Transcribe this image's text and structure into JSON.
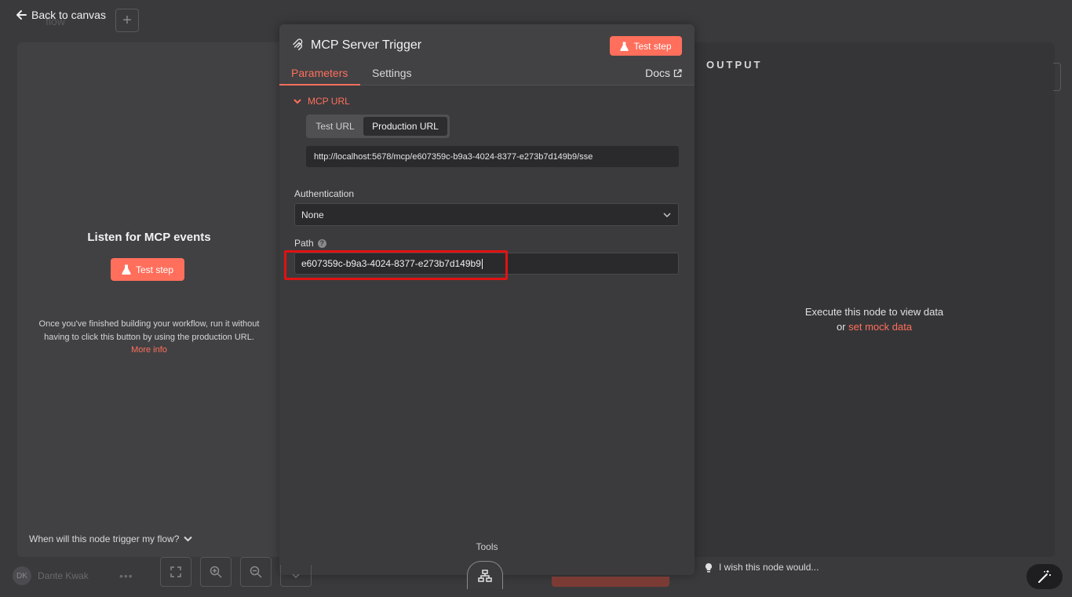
{
  "topbar": {
    "back_label": "Back to canvas",
    "ghost_title": "flow",
    "add_label": "+"
  },
  "input_panel": {
    "title": "Listen for MCP events",
    "test_step_label": "Test step",
    "hint_text": "Once you've finished building your workflow, run it without having to click this button by using the production URL.",
    "more_info_label": "More info",
    "trigger_question": "When will this node trigger my flow?"
  },
  "node": {
    "title": "MCP Server Trigger",
    "test_step_label": "Test step",
    "tabs": [
      {
        "label": "Parameters",
        "active": true
      },
      {
        "label": "Settings",
        "active": false
      }
    ],
    "docs_label": "Docs",
    "mcp_url": {
      "section_label": "MCP URL",
      "options": [
        "Test URL",
        "Production URL"
      ],
      "selected": "Production URL",
      "url": "http://localhost:5678/mcp/e607359c-b9a3-4024-8377-e273b7d149b9/sse"
    },
    "authentication": {
      "label": "Authentication",
      "value": "None"
    },
    "path": {
      "label": "Path",
      "value": "e607359c-b9a3-4024-8377-e273b7d149b9"
    },
    "tools_label": "Tools"
  },
  "output_panel": {
    "title": "OUTPUT",
    "empty_line1": "Execute this node to view data",
    "empty_or": "or",
    "mock_data_label": "set mock data"
  },
  "bottom": {
    "user_initials": "DK",
    "user_name": "Dante Kwak",
    "wish_label": "I wish this node would..."
  },
  "colors": {
    "accent": "#ff6f5c",
    "highlight": "#e11212"
  }
}
